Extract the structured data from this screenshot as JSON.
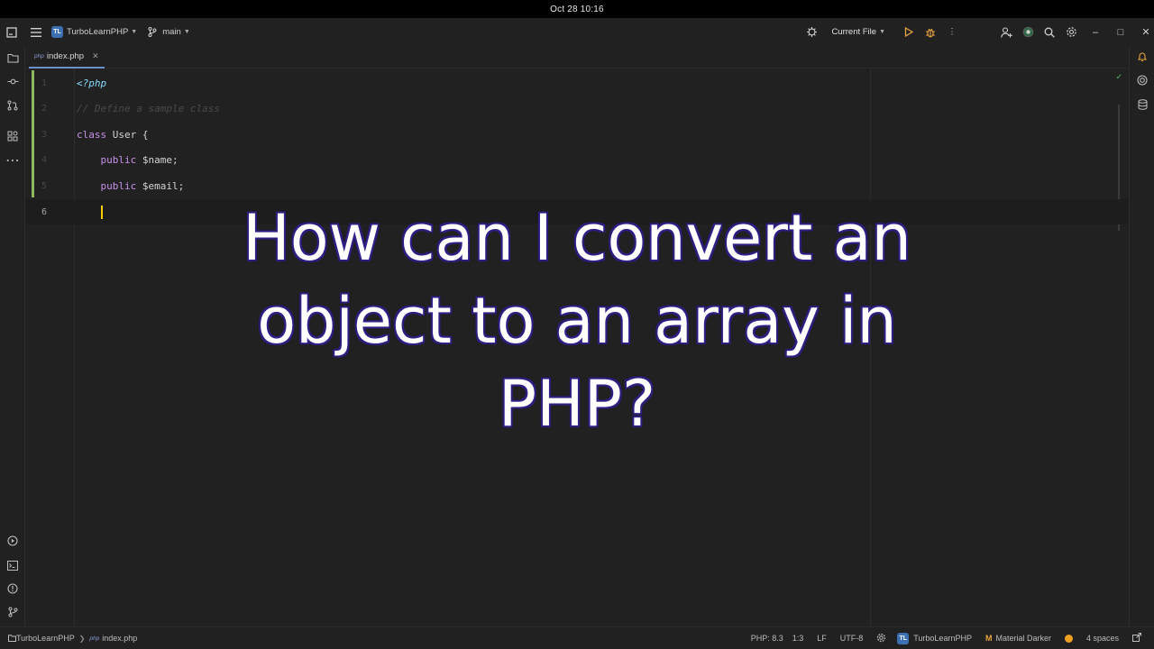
{
  "os": {
    "clock": "Oct 28  10:16"
  },
  "titlebar": {
    "project_badge": "TL",
    "project_name": "TurboLearnPHP",
    "branch": "main",
    "run_config": "Current File"
  },
  "tabs": [
    {
      "label": "index.php",
      "type_tag": "php"
    }
  ],
  "editor": {
    "line_numbers": [
      "1",
      "2",
      "3",
      "4",
      "5",
      "6"
    ],
    "lines": [
      {
        "text": "<?php"
      },
      {
        "text": "// Define a sample class"
      },
      {
        "kw": "class",
        "rest": " User {"
      },
      {
        "indent": "    ",
        "kw": "public",
        "rest": " $name;"
      },
      {
        "indent": "    ",
        "kw": "public",
        "rest": " $email;"
      },
      {
        "indent": "    "
      }
    ],
    "current_line": 6
  },
  "overlay": {
    "line1": "How can I convert an",
    "line2": "object to an array in",
    "line3": "PHP?"
  },
  "statusbar": {
    "breadcrumb_project": "TurboLearnPHP",
    "breadcrumb_file": "index.php",
    "php_version": "PHP: 8.3",
    "cursor_pos": "1:3",
    "line_ending": "LF",
    "encoding": "UTF-8",
    "project_badge": "TL",
    "project_name": "TurboLearnPHP",
    "theme": "Material Darker",
    "indent": "4 spaces"
  },
  "colors": {
    "keyword": "#c792ea",
    "php_tag": "#89ddff",
    "comment": "#4a4a4a",
    "caret": "#ffcc00",
    "vcs_added": "#8fb95f",
    "overlay_text": "#ffffff",
    "overlay_outline": "#2a1d7a"
  }
}
